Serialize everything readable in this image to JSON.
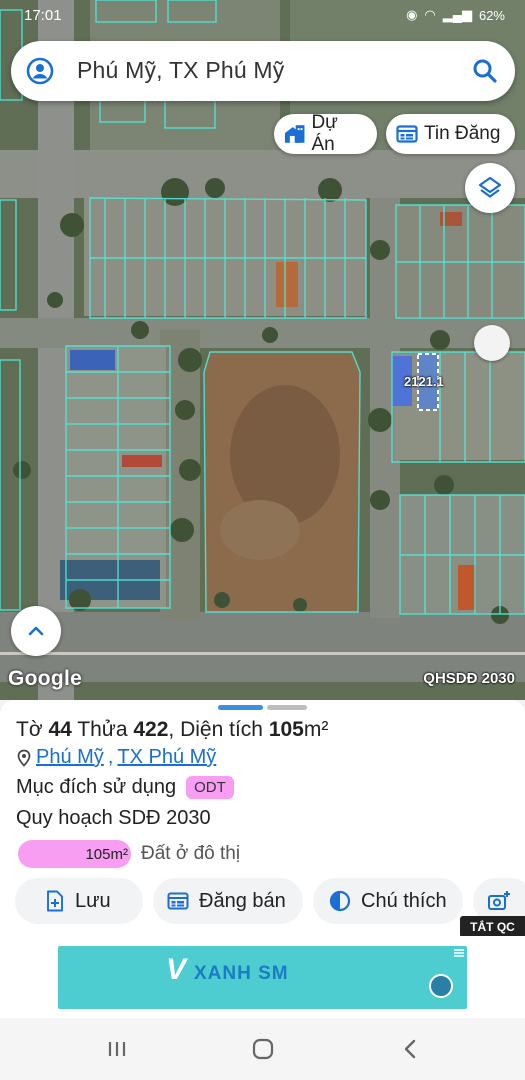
{
  "status_bar": {
    "time": "17:01",
    "battery": "62%"
  },
  "search": {
    "query": "Phú Mỹ, TX Phú Mỹ"
  },
  "map_chips": {
    "du_an": "Dự Án",
    "tin_dang": "Tin Đăng"
  },
  "map": {
    "parcel_label": "2121.1",
    "attribution": "Google",
    "watermark": "QHSDĐ 2030"
  },
  "parcel": {
    "sheet_prefix": "Tờ",
    "sheet_no": "44",
    "plot_prefix": "Thửa",
    "plot_no": "422",
    "area_prefix": ", Diện tích",
    "area_value": "105",
    "area_unit": "m²",
    "ward": "Phú Mỹ",
    "town": "TX Phú Mỹ",
    "purpose_label": "Mục đích sử dụng",
    "purpose_code": "ODT",
    "plan_label": "Quy hoạch SDĐ 2030",
    "plan_area": "105m²",
    "plan_area_value": 105,
    "plan_color": "#f79ef2",
    "plan_description": "Đất ở đô thị"
  },
  "actions": {
    "save": "Lưu",
    "post_sale": "Đăng bán",
    "legend": "Chú thích"
  },
  "ad": {
    "toggle_label": "TẮT QC",
    "brand": "XANH SM"
  },
  "colors": {
    "accent": "#1a6fd6",
    "parcel_lines": "#4fe8d8",
    "selected": "#3b7cff"
  }
}
